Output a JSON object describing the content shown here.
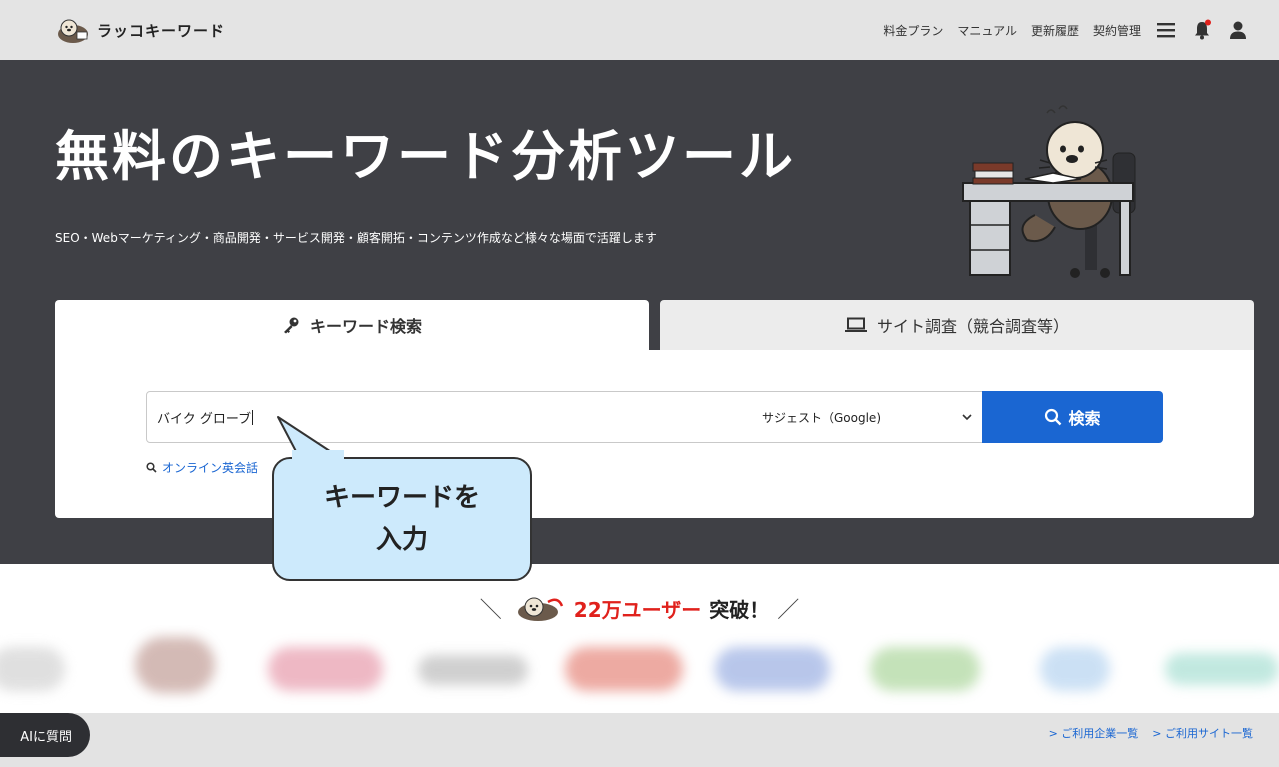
{
  "header": {
    "logo_text": "ラッコキーワード",
    "nav": [
      "料金プラン",
      "マニュアル",
      "更新履歴",
      "契約管理"
    ],
    "icons": [
      "menu-icon",
      "bell-icon",
      "user-icon"
    ]
  },
  "hero": {
    "title": "無料のキーワード分析ツール",
    "subtitle": "SEO・Webマーケティング・商品開発・サービス開発・顧客開拓・コンテンツ作成など様々な場面で活躍します"
  },
  "search": {
    "tab_keyword": "キーワード検索",
    "tab_site": "サイト調査（競合調査等）",
    "input_value": "バイク グローブ",
    "select_value": "サジェスト（Google)",
    "button_label": "検索",
    "suggest_link": "オンライン英会話"
  },
  "callout": {
    "line1": "キーワードを",
    "line2": "入力"
  },
  "users": {
    "count": "22万ユーザー",
    "rest": "突破！"
  },
  "footer": {
    "ai_button": "AIに質問",
    "links": [
      "> ご利用企業一覧",
      "> ご利用サイト一覧"
    ]
  },
  "colors": {
    "header_bg": "#e4e4e4",
    "hero_bg": "#3f4045",
    "primary": "#1a66d2",
    "accent_red": "#e0211c",
    "callout_bg": "#cdeafc"
  }
}
